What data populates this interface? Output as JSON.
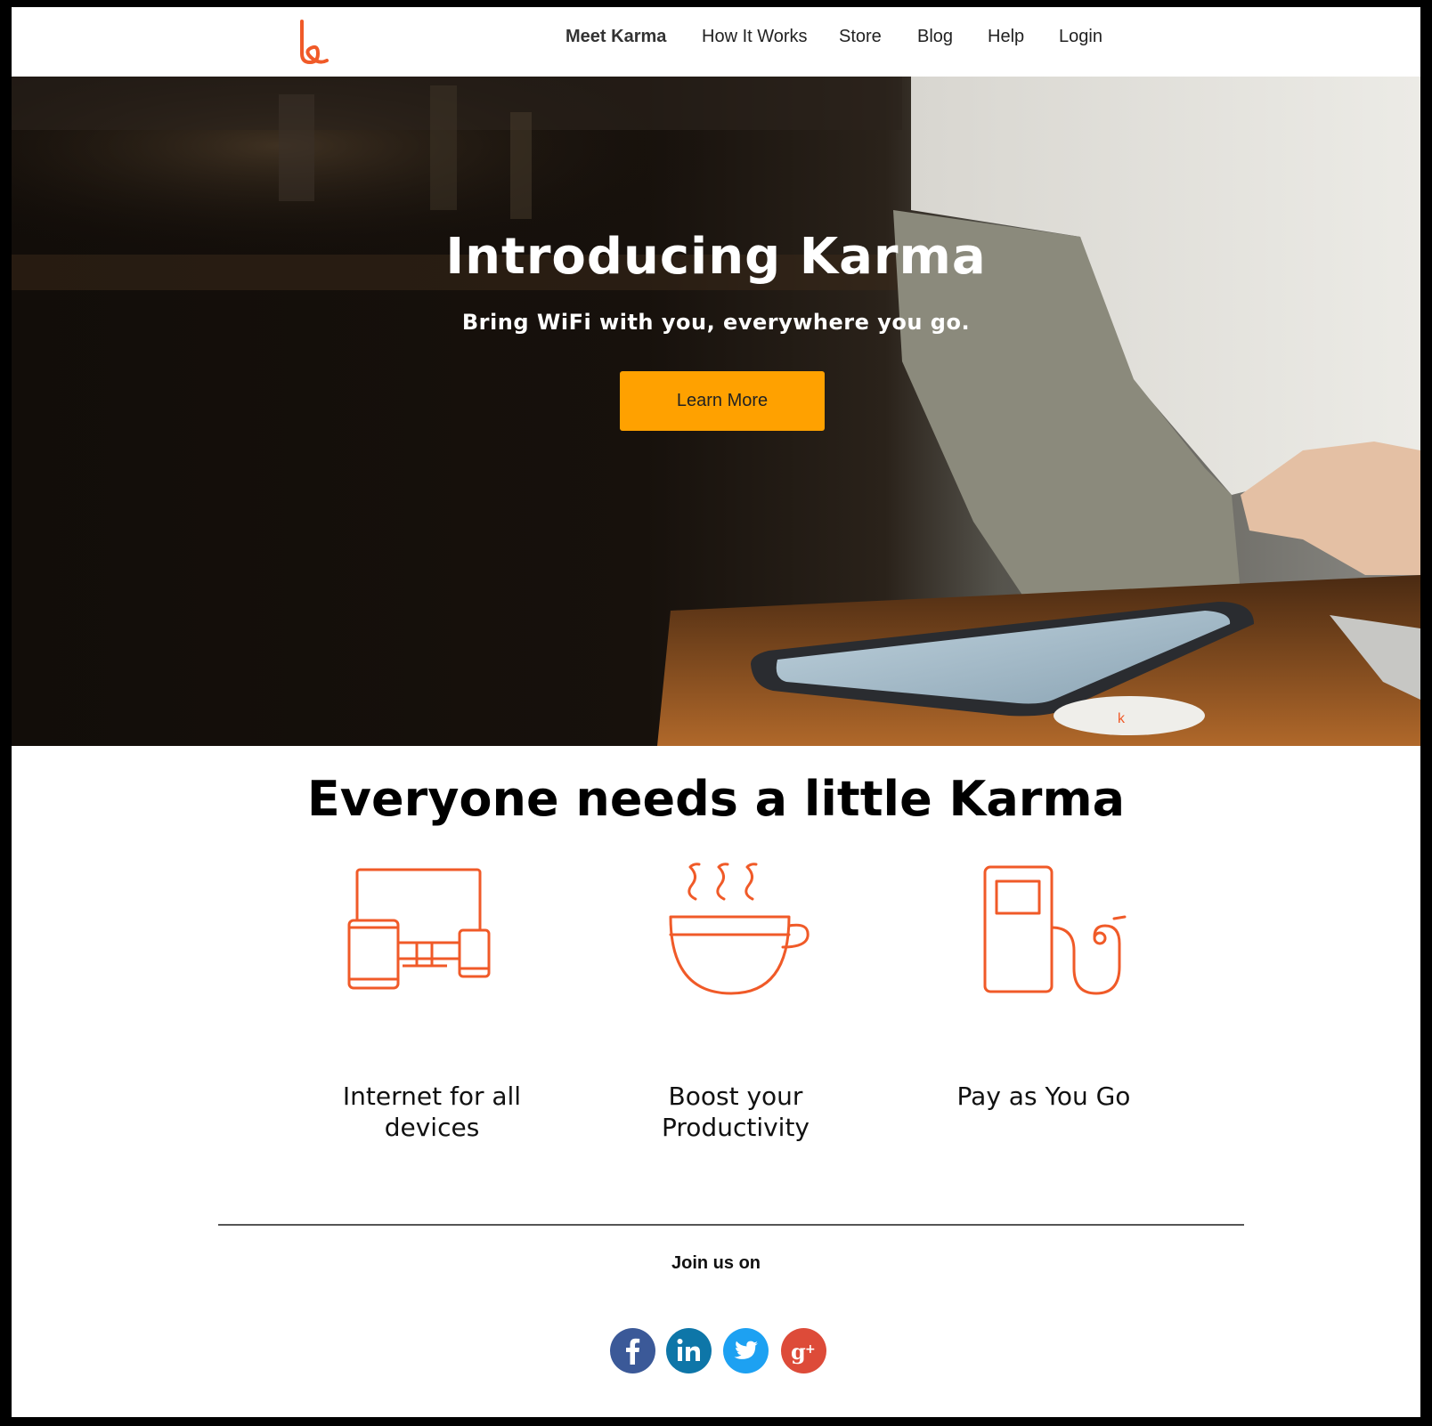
{
  "header": {
    "logo_alt": "Karma logo",
    "nav": [
      {
        "label": "Meet Karma",
        "active": true
      },
      {
        "label": "How It Works"
      },
      {
        "label": "Store"
      },
      {
        "label": "Blog"
      },
      {
        "label": "Help"
      },
      {
        "label": "Login"
      }
    ]
  },
  "hero": {
    "title": "Introducing Karma",
    "subtitle": "Bring WiFi with you, everywhere you go.",
    "cta_label": "Learn More"
  },
  "features": {
    "title": "Everyone needs a little Karma",
    "items": [
      {
        "icon": "devices-icon",
        "line1": "Internet for all",
        "line2": "devices"
      },
      {
        "icon": "coffee-cup-icon",
        "line1": "Boost your",
        "line2": "Productivity"
      },
      {
        "icon": "fuel-pump-icon",
        "line1": "Pay as You Go",
        "line2": ""
      }
    ]
  },
  "footer": {
    "join_label": "Join us on",
    "social": [
      {
        "name": "facebook-icon",
        "glyph": "f",
        "color": "#3b5998"
      },
      {
        "name": "linkedin-icon",
        "glyph": "in",
        "color": "#0e76a8"
      },
      {
        "name": "twitter-icon",
        "glyph": "t",
        "color": "#1da1f2"
      },
      {
        "name": "google-plus-icon",
        "glyph": "g+",
        "color": "#dd4b39"
      }
    ]
  },
  "colors": {
    "accent": "#f05a28",
    "cta": "#ffa100"
  }
}
